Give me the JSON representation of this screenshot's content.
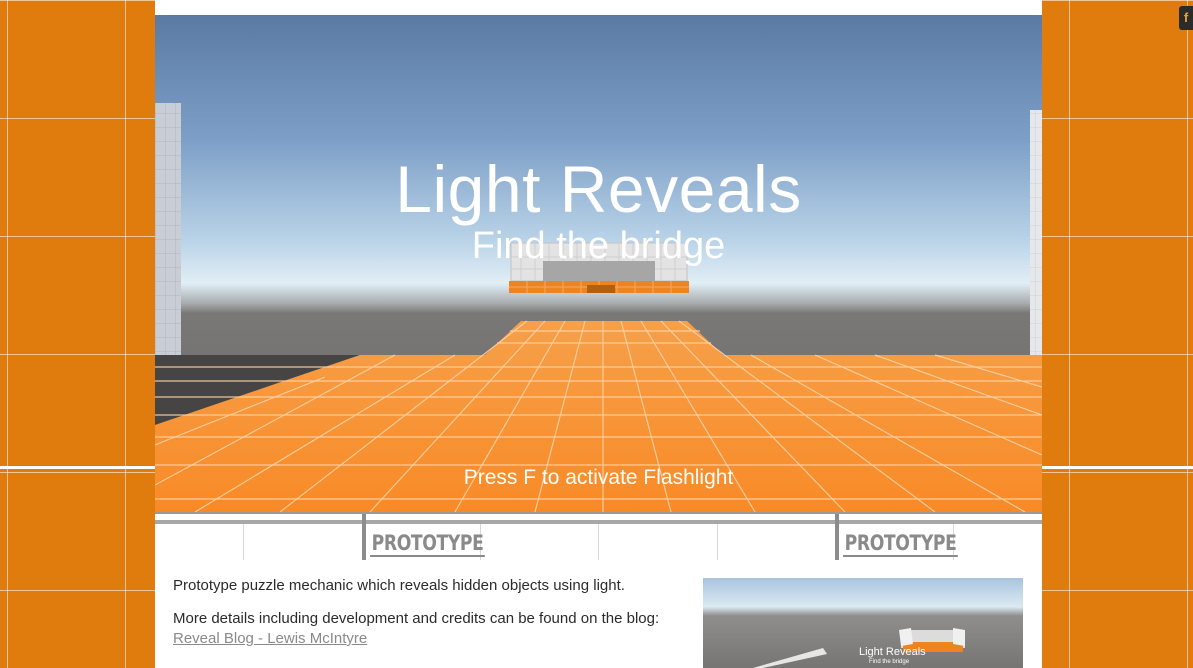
{
  "game": {
    "title": "Light Reveals",
    "subtitle": "Find the bridge",
    "hint": "Press F to activate Flashlight"
  },
  "banner": {
    "labels": [
      "PROTOTYPE",
      "PROTOTYPE"
    ]
  },
  "description": {
    "line1": "Prototype puzzle mechanic which reveals hidden objects using light.",
    "line2": "More details including development and credits can be found on the blog:",
    "link_text": "Reveal Blog - Lewis McIntyre"
  },
  "thumbnail": {
    "title": "Light Reveals",
    "subtitle": "Find the bridge"
  },
  "corner_button": {
    "label": "f"
  },
  "colors": {
    "background_orange": "#df7c0d",
    "floor_orange": "#f88e2a",
    "sky_top": "#5a7aa3",
    "link_gray": "#8a8a8a"
  }
}
